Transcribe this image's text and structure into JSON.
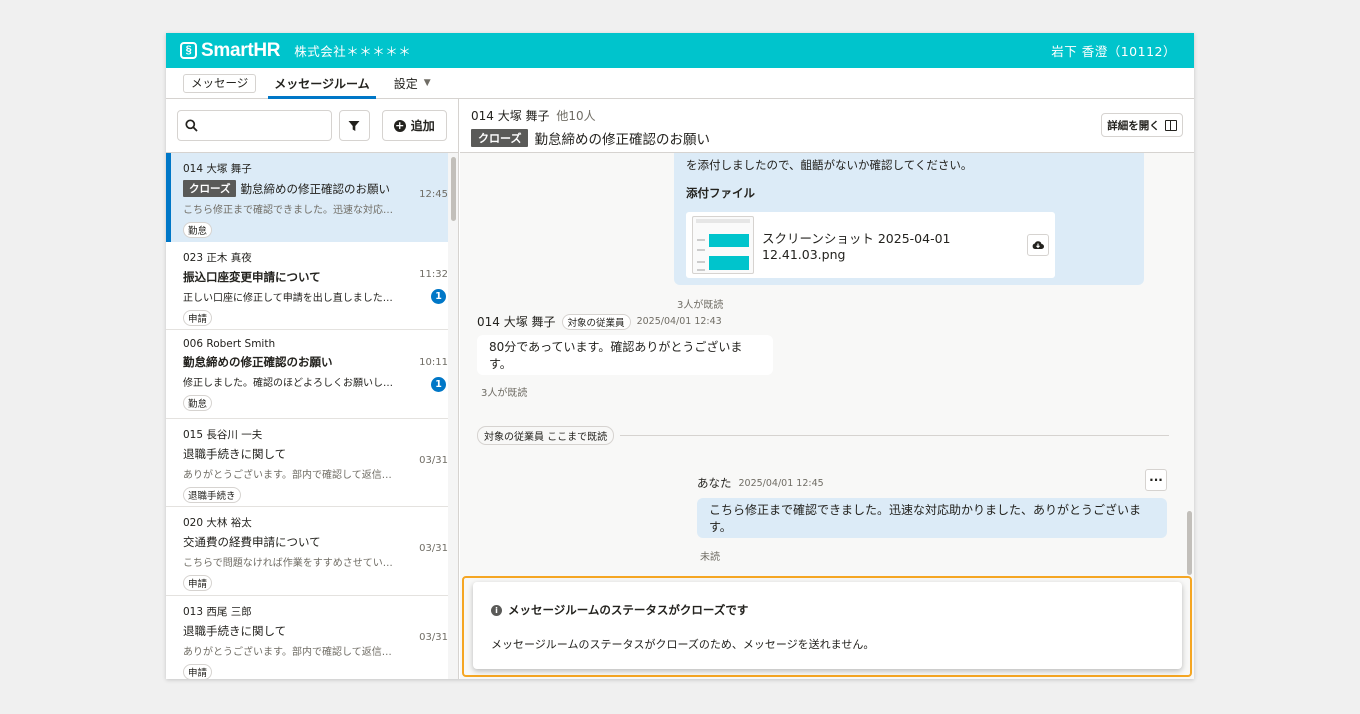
{
  "header": {
    "logo_mark": "§",
    "logo_text": "SmartHR",
    "company": "株式会社＊＊＊＊＊",
    "user": "岩下 香澄（10112）",
    "bg_color": "#00c4cc"
  },
  "tabs": [
    {
      "label": "メッセージ"
    },
    {
      "label": "メッセージルーム"
    },
    {
      "label": "設定"
    }
  ],
  "sidebar": {
    "search_placeholder": "",
    "add_label": "追加",
    "rooms": [
      {
        "who": "014 大塚 舞子",
        "tag": "クローズ",
        "title": "勤怠締めの修正確認のお願い",
        "preview": "こちら修正まで確認できました。迅速な対応…",
        "chip": "勤怠",
        "time": "12:45",
        "unread": ""
      },
      {
        "who": "023 正木 真夜",
        "tag": "",
        "title": "振込口座変更申請について",
        "preview": "正しい口座に修正して申請を出し直しました…",
        "chip": "申請",
        "time": "11:32",
        "unread": "1"
      },
      {
        "who": "006 Robert Smith",
        "tag": "",
        "title": "勤怠締めの修正確認のお願い",
        "preview": "修正しました。確認のほどよろしくお願いし…",
        "chip": "勤怠",
        "time": "10:11",
        "unread": "1"
      },
      {
        "who": "015 長谷川 一夫",
        "tag": "",
        "title": "退職手続きに関して",
        "preview": "ありがとうございます。部内で確認して返信…",
        "chip": "退職手続き",
        "time": "03/31",
        "unread": ""
      },
      {
        "who": "020 大林 裕太",
        "tag": "",
        "title": "交通費の経費申請について",
        "preview": "こちらで問題なければ作業をすすめさせてい…",
        "chip": "申請",
        "time": "03/31",
        "unread": ""
      },
      {
        "who": "013 西尾 三郎",
        "tag": "",
        "title": "退職手続きに関して",
        "preview": "ありがとうございます。部内で確認して返信…",
        "chip": "申請",
        "time": "03/31",
        "unread": ""
      }
    ]
  },
  "room_header": {
    "members": "014 大塚 舞子",
    "members_extra": "他10人",
    "tag": "クローズ",
    "title": "勤怠締めの修正確認のお願い",
    "details_label": "詳細を開く"
  },
  "messages": {
    "top_text": "を添付しましたので、齟齬がないか確認してください。",
    "attach_label": "添付ファイル",
    "file_name": "スクリーンショット 2025-04-01 12.41.03.png",
    "read_count_1": "3人が既読",
    "msg2_name": "014 大塚 舞子",
    "msg2_role": "対象の従業員",
    "msg2_time": "2025/04/01 12:43",
    "msg2_text": "80分であっています。確認ありがとうございます。",
    "read_count_2": "3人が既読",
    "divider_label": "対象の従業員 ここまで既読",
    "msg3_name": "あなた",
    "msg3_time": "2025/04/01 12:45",
    "msg3_more": "···",
    "msg3_text": "こちら修正まで確認できました。迅速な対応助かりました、ありがとうございます。",
    "unread_label": "未読"
  },
  "notice": {
    "title": "メッセージルームのステータスがクローズです",
    "body": "メッセージルームのステータスがクローズのため、メッセージを送れません。"
  }
}
